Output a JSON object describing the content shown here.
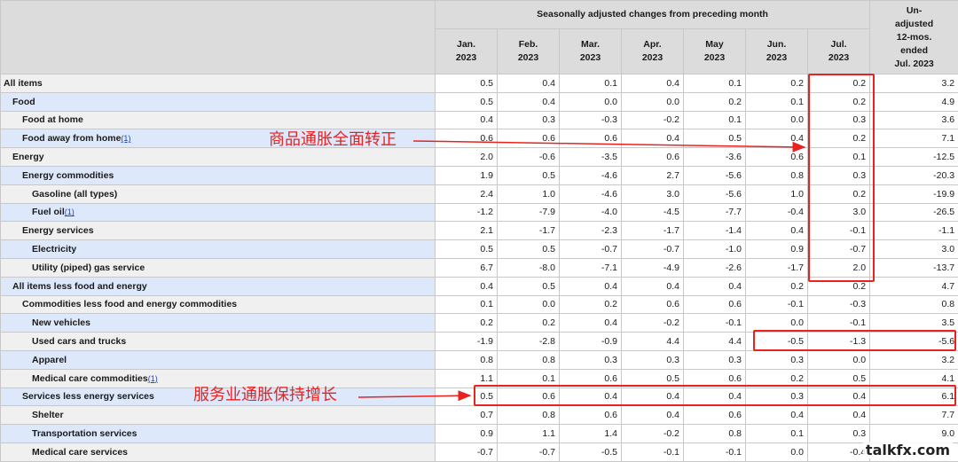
{
  "header": {
    "group_title": "Seasonally adjusted changes from preceding month",
    "months": [
      [
        "Jan.",
        "2023"
      ],
      [
        "Feb.",
        "2023"
      ],
      [
        "Mar.",
        "2023"
      ],
      [
        "Apr.",
        "2023"
      ],
      [
        "May",
        "2023"
      ],
      [
        "Jun.",
        "2023"
      ],
      [
        "Jul.",
        "2023"
      ]
    ],
    "unadjusted": [
      "Un-",
      "adjusted",
      "12-mos.",
      "ended",
      "Jul. 2023"
    ]
  },
  "rows": [
    {
      "label": "All items",
      "level": 0,
      "fn": "",
      "values": [
        "0.5",
        "0.4",
        "0.1",
        "0.4",
        "0.1",
        "0.2",
        "0.2",
        "3.2"
      ]
    },
    {
      "label": "Food",
      "level": 1,
      "fn": "",
      "values": [
        "0.5",
        "0.4",
        "0.0",
        "0.0",
        "0.2",
        "0.1",
        "0.2",
        "4.9"
      ]
    },
    {
      "label": "Food at home",
      "level": 2,
      "fn": "",
      "values": [
        "0.4",
        "0.3",
        "-0.3",
        "-0.2",
        "0.1",
        "0.0",
        "0.3",
        "3.6"
      ]
    },
    {
      "label": "Food away from home",
      "level": 2,
      "fn": "(1)",
      "values": [
        "0.6",
        "0.6",
        "0.6",
        "0.4",
        "0.5",
        "0.4",
        "0.2",
        "7.1"
      ]
    },
    {
      "label": "Energy",
      "level": 1,
      "fn": "",
      "values": [
        "2.0",
        "-0.6",
        "-3.5",
        "0.6",
        "-3.6",
        "0.6",
        "0.1",
        "-12.5"
      ]
    },
    {
      "label": "Energy commodities",
      "level": 2,
      "fn": "",
      "values": [
        "1.9",
        "0.5",
        "-4.6",
        "2.7",
        "-5.6",
        "0.8",
        "0.3",
        "-20.3"
      ]
    },
    {
      "label": "Gasoline (all types)",
      "level": 3,
      "fn": "",
      "values": [
        "2.4",
        "1.0",
        "-4.6",
        "3.0",
        "-5.6",
        "1.0",
        "0.2",
        "-19.9"
      ]
    },
    {
      "label": "Fuel oil",
      "level": 3,
      "fn": "(1)",
      "values": [
        "-1.2",
        "-7.9",
        "-4.0",
        "-4.5",
        "-7.7",
        "-0.4",
        "3.0",
        "-26.5"
      ]
    },
    {
      "label": "Energy services",
      "level": 2,
      "fn": "",
      "values": [
        "2.1",
        "-1.7",
        "-2.3",
        "-1.7",
        "-1.4",
        "0.4",
        "-0.1",
        "-1.1"
      ]
    },
    {
      "label": "Electricity",
      "level": 3,
      "fn": "",
      "values": [
        "0.5",
        "0.5",
        "-0.7",
        "-0.7",
        "-1.0",
        "0.9",
        "-0.7",
        "3.0"
      ]
    },
    {
      "label": "Utility (piped) gas service",
      "level": 3,
      "fn": "",
      "values": [
        "6.7",
        "-8.0",
        "-7.1",
        "-4.9",
        "-2.6",
        "-1.7",
        "2.0",
        "-13.7"
      ]
    },
    {
      "label": "All items less food and energy",
      "level": 1,
      "fn": "",
      "values": [
        "0.4",
        "0.5",
        "0.4",
        "0.4",
        "0.4",
        "0.2",
        "0.2",
        "4.7"
      ]
    },
    {
      "label": "Commodities less food and energy commodities",
      "level": 2,
      "fn": "",
      "values": [
        "0.1",
        "0.0",
        "0.2",
        "0.6",
        "0.6",
        "-0.1",
        "-0.3",
        "0.8"
      ]
    },
    {
      "label": "New vehicles",
      "level": 3,
      "fn": "",
      "values": [
        "0.2",
        "0.2",
        "0.4",
        "-0.2",
        "-0.1",
        "0.0",
        "-0.1",
        "3.5"
      ]
    },
    {
      "label": "Used cars and trucks",
      "level": 3,
      "fn": "",
      "values": [
        "-1.9",
        "-2.8",
        "-0.9",
        "4.4",
        "4.4",
        "-0.5",
        "-1.3",
        "-5.6"
      ]
    },
    {
      "label": "Apparel",
      "level": 3,
      "fn": "",
      "values": [
        "0.8",
        "0.8",
        "0.3",
        "0.3",
        "0.3",
        "0.3",
        "0.0",
        "3.2"
      ]
    },
    {
      "label": "Medical care commodities",
      "level": 3,
      "fn": "(1)",
      "values": [
        "1.1",
        "0.1",
        "0.6",
        "0.5",
        "0.6",
        "0.2",
        "0.5",
        "4.1"
      ]
    },
    {
      "label": "Services less energy services",
      "level": 2,
      "fn": "",
      "values": [
        "0.5",
        "0.6",
        "0.4",
        "0.4",
        "0.4",
        "0.3",
        "0.4",
        "6.1"
      ]
    },
    {
      "label": "Shelter",
      "level": 3,
      "fn": "",
      "values": [
        "0.7",
        "0.8",
        "0.6",
        "0.4",
        "0.6",
        "0.4",
        "0.4",
        "7.7"
      ]
    },
    {
      "label": "Transportation services",
      "level": 3,
      "fn": "",
      "values": [
        "0.9",
        "1.1",
        "1.4",
        "-0.2",
        "0.8",
        "0.1",
        "0.3",
        "9.0"
      ]
    },
    {
      "label": "Medical care services",
      "level": 3,
      "fn": "",
      "values": [
        "-0.7",
        "-0.7",
        "-0.5",
        "-0.1",
        "-0.1",
        "0.0",
        "-0.4",
        ""
      ]
    }
  ],
  "annotations": {
    "goods": "商品通胀全面转正",
    "services": "服务业通胀保持增长"
  },
  "colors": {
    "annotation_red": "#e8231f",
    "header_gray": "#dcdcdc",
    "label_blue": "#dde8fb",
    "label_gray": "#f0f0f0"
  },
  "watermark": "talkfx.com"
}
